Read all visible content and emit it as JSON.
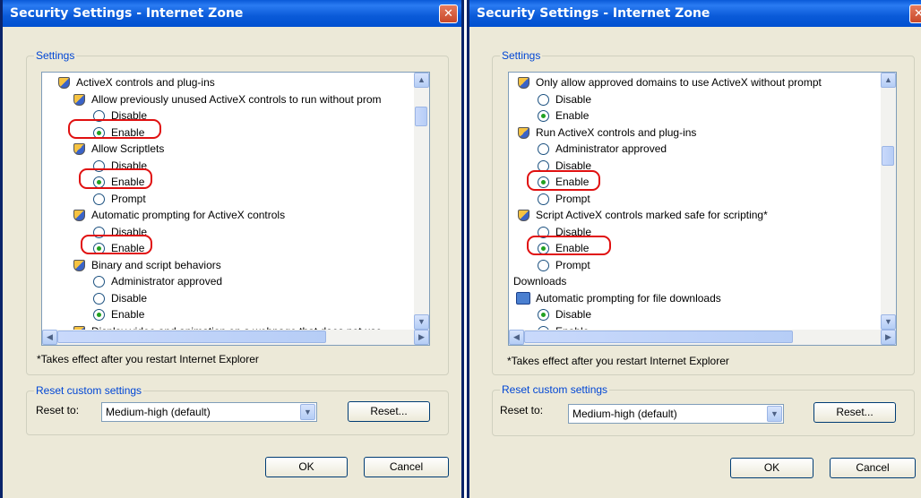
{
  "left": {
    "title": "Security Settings - Internet Zone",
    "close": "✕",
    "settings_label": "Settings",
    "rows": [
      {
        "kind": "shield",
        "text": "ActiveX controls and plug-ins"
      },
      {
        "kind": "shield",
        "text": "Allow previously unused ActiveX controls to run without prom"
      },
      {
        "kind": "radio",
        "on": false,
        "text": "Disable"
      },
      {
        "kind": "radio",
        "on": true,
        "text": "Enable"
      },
      {
        "kind": "shield",
        "text": "Allow Scriptlets"
      },
      {
        "kind": "radio",
        "on": false,
        "text": "Disable"
      },
      {
        "kind": "radio",
        "on": true,
        "text": "Enable"
      },
      {
        "kind": "radio",
        "on": false,
        "text": "Prompt"
      },
      {
        "kind": "shield",
        "text": "Automatic prompting for ActiveX controls"
      },
      {
        "kind": "radio",
        "on": false,
        "text": "Disable"
      },
      {
        "kind": "radio",
        "on": true,
        "text": "Enable"
      },
      {
        "kind": "shield",
        "text": "Binary and script behaviors"
      },
      {
        "kind": "radio",
        "on": false,
        "text": "Administrator approved"
      },
      {
        "kind": "radio",
        "on": false,
        "text": "Disable"
      },
      {
        "kind": "radio",
        "on": true,
        "text": "Enable"
      },
      {
        "kind": "shield",
        "text": "Display video and animation on a webpage that does not use"
      }
    ],
    "note": "*Takes effect after you restart Internet Explorer",
    "reset_group_label": "Reset custom settings",
    "reset_to_label": "Reset to:",
    "reset_select_value": "Medium-high (default)",
    "reset_button": "Reset...",
    "ok_button": "OK",
    "cancel_button": "Cancel"
  },
  "right": {
    "title": "Security Settings - Internet Zone",
    "close": "✕",
    "settings_label": "Settings",
    "rows": [
      {
        "kind": "shield",
        "text": "Only allow approved domains to use ActiveX without prompt"
      },
      {
        "kind": "radio",
        "on": false,
        "text": "Disable"
      },
      {
        "kind": "radio",
        "on": true,
        "text": "Enable"
      },
      {
        "kind": "shield",
        "text": "Run ActiveX controls and plug-ins"
      },
      {
        "kind": "radio",
        "on": false,
        "text": "Administrator approved"
      },
      {
        "kind": "radio",
        "on": false,
        "text": "Disable"
      },
      {
        "kind": "radio",
        "on": true,
        "text": "Enable"
      },
      {
        "kind": "radio",
        "on": false,
        "text": "Prompt"
      },
      {
        "kind": "shield",
        "text": "Script ActiveX controls marked safe for scripting*"
      },
      {
        "kind": "radio",
        "on": false,
        "text": "Disable"
      },
      {
        "kind": "radio",
        "on": true,
        "text": "Enable"
      },
      {
        "kind": "radio",
        "on": false,
        "text": "Prompt"
      },
      {
        "kind": "category",
        "text": "Downloads"
      },
      {
        "kind": "download",
        "text": "Automatic prompting for file downloads"
      },
      {
        "kind": "radio",
        "on": true,
        "text": "Disable"
      },
      {
        "kind": "radio",
        "on": false,
        "text": "Enable"
      }
    ],
    "note": "*Takes effect after you restart Internet Explorer",
    "reset_group_label": "Reset custom settings",
    "reset_to_label": "Reset to:",
    "reset_select_value": "Medium-high (default)",
    "reset_button": "Reset...",
    "ok_button": "OK",
    "cancel_button": "Cancel"
  },
  "colors": {
    "title_bar": "#0a5ad8",
    "highlight": "#e01010",
    "group_label": "#0046d5"
  }
}
